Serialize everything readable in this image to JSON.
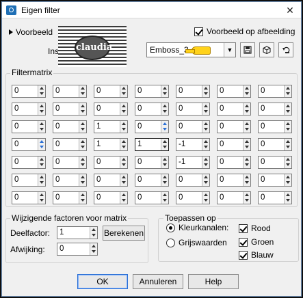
{
  "window": {
    "title": "Eigen filter"
  },
  "top": {
    "preview_expander": "Voorbeeld",
    "settings_label": "Instellingen",
    "logo_text": "claudia",
    "preview_on_image": {
      "label": "Voorbeeld op afbeelding",
      "checked": true
    },
    "preset": {
      "value": "Emboss_3"
    }
  },
  "matrix": {
    "title": "Filtermatrix",
    "rows": [
      [
        "0",
        "0",
        "0",
        "0",
        "0",
        "0",
        "0"
      ],
      [
        "0",
        "0",
        "0",
        "0",
        "0",
        "0",
        "0"
      ],
      [
        "0",
        "0",
        "1",
        "0",
        "0",
        "0",
        "0"
      ],
      [
        "0",
        "0",
        "1",
        "1",
        "-1",
        "0",
        "0"
      ],
      [
        "0",
        "0",
        "0",
        "0",
        "-1",
        "0",
        "0"
      ],
      [
        "0",
        "0",
        "0",
        "0",
        "0",
        "0",
        "0"
      ],
      [
        "0",
        "0",
        "0",
        "0",
        "0",
        "0",
        "0"
      ]
    ]
  },
  "factors": {
    "title": "Wijzigende factoren voor matrix",
    "divisor_label": "Deelfactor:",
    "divisor_value": "1",
    "compute_button": "Berekenen",
    "bias_label": "Afwijking:",
    "bias_value": "0"
  },
  "apply": {
    "title": "Toepassen op",
    "color_channels": "Kleurkanalen:",
    "grayscale": "Grijswaarden",
    "selected": "color_channels",
    "red": {
      "label": "Rood",
      "checked": true
    },
    "green": {
      "label": "Groen",
      "checked": true
    },
    "blue": {
      "label": "Blauw",
      "checked": true
    }
  },
  "buttons": {
    "ok": "OK",
    "cancel": "Annuleren",
    "help": "Help"
  },
  "icons": {
    "title": "filter-app-icon",
    "close": "close-icon",
    "save": "save-preset-icon",
    "load": "load-preset-icon",
    "reset": "reset-icon",
    "pointer": "pointing-hand-icon"
  }
}
